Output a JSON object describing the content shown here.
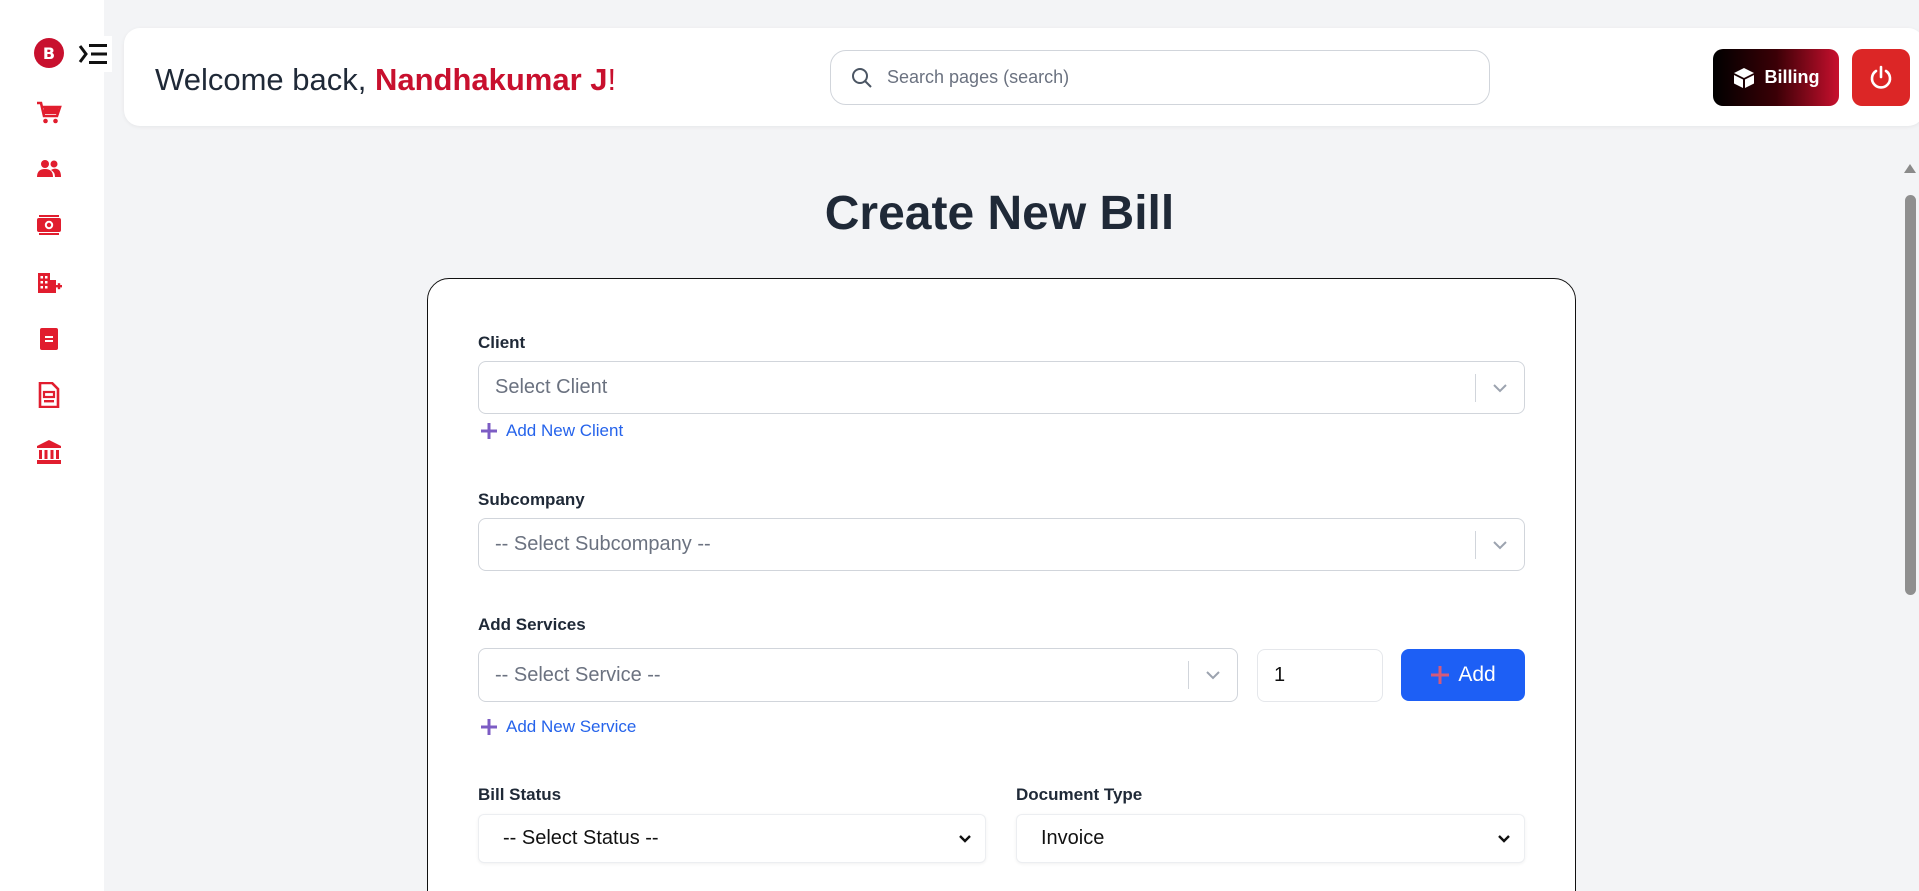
{
  "sidebar": {
    "logo_letter": "B",
    "items": [
      {
        "icon": "cart-icon"
      },
      {
        "icon": "users-icon"
      },
      {
        "icon": "money-icon"
      },
      {
        "icon": "building-add-icon"
      },
      {
        "icon": "document-icon"
      },
      {
        "icon": "receipt-icon"
      },
      {
        "icon": "bank-icon"
      }
    ]
  },
  "header": {
    "welcome_prefix": "Welcome back, ",
    "user_name": "Nandhakumar J",
    "welcome_suffix": "!",
    "search_placeholder": "Search pages (search)",
    "billing_label": "Billing"
  },
  "page": {
    "title": "Create New Bill"
  },
  "form": {
    "client": {
      "label": "Client",
      "placeholder": "Select Client",
      "add_link": "Add New Client"
    },
    "subcompany": {
      "label": "Subcompany",
      "placeholder": "-- Select Subcompany --"
    },
    "services": {
      "label": "Add Services",
      "placeholder": "-- Select Service --",
      "quantity": "1",
      "add_button": "Add",
      "add_link": "Add New Service"
    },
    "bill_status": {
      "label": "Bill Status",
      "value": "-- Select Status --"
    },
    "document_type": {
      "label": "Document Type",
      "value": "Invoice"
    }
  },
  "colors": {
    "brand_red": "#c8102e",
    "primary_blue": "#1d5ff5",
    "link_blue": "#2563eb",
    "plus_purple": "#7c5cc4"
  }
}
